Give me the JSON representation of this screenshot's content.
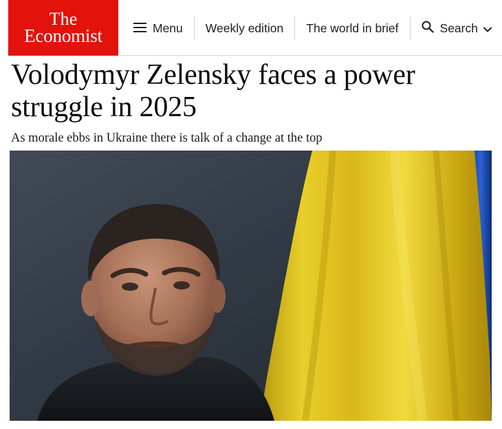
{
  "brand": {
    "line1": "The",
    "line2": "Economist",
    "color": "#e3120b"
  },
  "nav": {
    "menu": {
      "label": "Menu",
      "icon": "hamburger-menu-icon"
    },
    "weekly": {
      "label": "Weekly edition"
    },
    "world": {
      "label": "The world in brief"
    },
    "search": {
      "label": "Search",
      "icon": "search-icon",
      "chevron": "chevron-down-icon"
    }
  },
  "article": {
    "headline": "Volodymyr Zelensky faces a power struggle in 2025",
    "standfirst": "As morale ebbs in Ukraine there is talk of a change at the top",
    "image": {
      "subject": "man-portrait",
      "background": "ukrainian-flag"
    }
  },
  "colors": {
    "flag_yellow": "#e2c21c",
    "flag_blue": "#1f57c9",
    "text": "#0d0d0d"
  }
}
